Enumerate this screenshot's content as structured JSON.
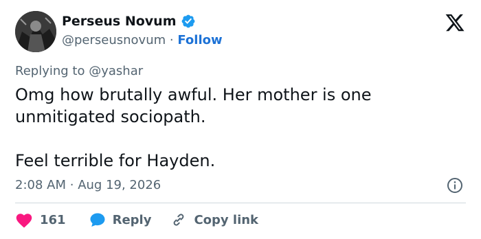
{
  "author": {
    "display_name": "Perseus Novum",
    "handle": "@perseusnovum",
    "separator": "·",
    "follow_label": "Follow",
    "verified": true
  },
  "reply_context": {
    "prefix": "Replying to",
    "handle": "@yashar"
  },
  "tweet": {
    "paragraphs": [
      "Omg how brutally awful. Her mother is one unmitigated sociopath.",
      "Feel terrible for Hayden."
    ],
    "time": "2:08 AM",
    "date": "Aug 19, 2026",
    "timestamp_separator": "·"
  },
  "actions": {
    "likes": "161",
    "reply_label": "Reply",
    "copy_link_label": "Copy link"
  },
  "icons": {
    "avatar": "profile-photo",
    "verified": "verified-badge-icon",
    "logo": "x-logo-icon",
    "info": "info-icon",
    "like": "heart-icon",
    "reply": "speech-bubble-icon",
    "copy": "link-icon"
  },
  "colors": {
    "text": "#0f1419",
    "secondary": "#536471",
    "link": "#1d72d6",
    "verified": "#1d9bf0",
    "heart": "#f91880",
    "divider": "#cfd9de"
  }
}
